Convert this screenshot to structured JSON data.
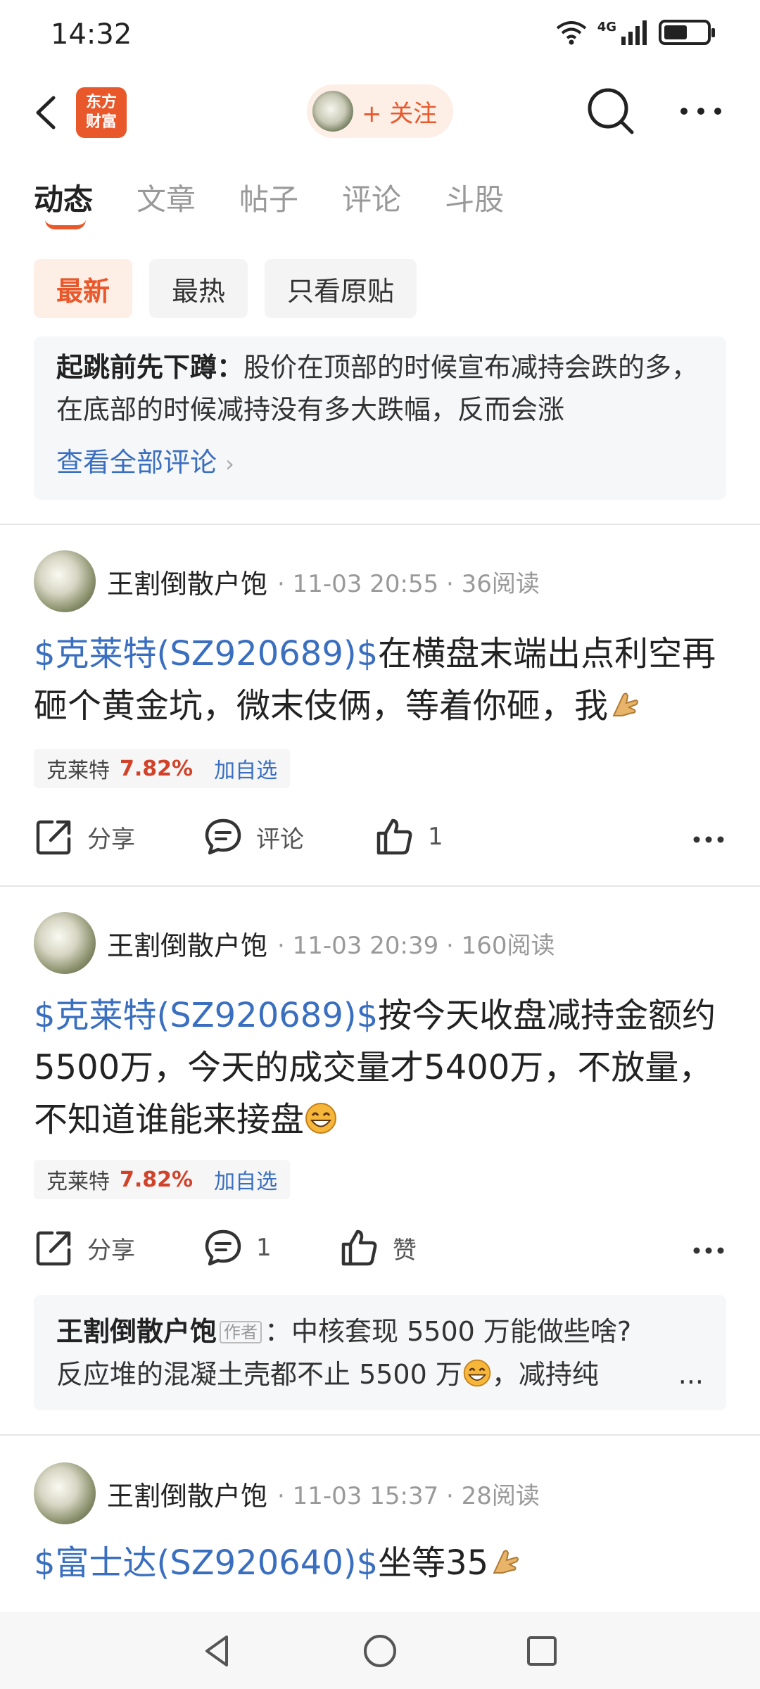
{
  "status": {
    "time": "14:32",
    "network": "4G",
    "battery_level": 0.55
  },
  "header": {
    "logo_line1": "东方",
    "logo_line2": "财富",
    "follow_label": "+ 关注"
  },
  "tabs": [
    {
      "label": "动态",
      "active": true
    },
    {
      "label": "文章",
      "active": false
    },
    {
      "label": "帖子",
      "active": false
    },
    {
      "label": "评论",
      "active": false
    },
    {
      "label": "斗股",
      "active": false
    }
  ],
  "filters": [
    {
      "label": "最新",
      "active": true
    },
    {
      "label": "最热",
      "active": false
    },
    {
      "label": "只看原贴",
      "active": false
    }
  ],
  "top_comment": {
    "author": "起跳前先下蹲",
    "separator": "：",
    "text": "股价在顶部的时候宣布减持会跌的多，在底部的时候减持没有多大跌幅，反而会涨",
    "view_all": "查看全部评论"
  },
  "posts": [
    {
      "author": "王割倒散户饱",
      "meta": "· 11-03 20:55 · 36阅读",
      "ticker": "$克莱特(SZ920689)$",
      "text": "在横盘末端出点利空再砸个黄金坑，微末伎俩，等着你砸，我",
      "emoji": "pray-hands-icon",
      "stock_name": "克莱特",
      "stock_pct": "7.82%",
      "stock_add": "加自选",
      "share": "分享",
      "comment": "评论",
      "like": "1"
    },
    {
      "author": "王割倒散户饱",
      "meta": "· 11-03 20:39 · 160阅读",
      "ticker": "$克莱特(SZ920689)$",
      "text": "按今天收盘减持金额约5500万，今天的成交量才5400万，不放量，不知道谁能来接盘",
      "emoji": "grin-emoji-icon",
      "stock_name": "克莱特",
      "stock_pct": "7.82%",
      "stock_add": "加自选",
      "share": "分享",
      "comment": "1",
      "like": "赞",
      "reply": {
        "author": "王割倒散户饱",
        "badge": "作者",
        "text_a": "：中核套现 5500 万能做些啥?",
        "text_b": "反应堆的混凝土壳都不止 5500 万",
        "text_c": "，减持纯",
        "more": "..."
      }
    },
    {
      "author": "王割倒散户饱",
      "meta": "· 11-03 15:37 · 28阅读",
      "ticker": "$富士达(SZ920640)$",
      "text": "坐等35",
      "emoji": "pray-hands-icon"
    }
  ],
  "colors": {
    "accent": "#e8582a",
    "link": "#3a6fc0",
    "up": "#d0432a"
  }
}
